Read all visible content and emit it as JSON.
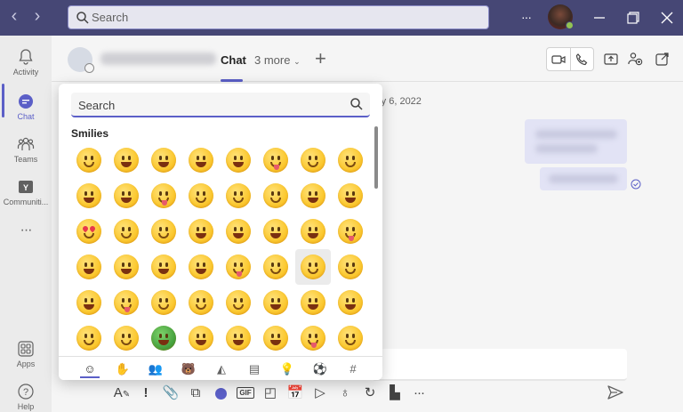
{
  "titlebar": {
    "search_placeholder": "Search",
    "more_label": "···",
    "back_glyph": "‹",
    "forward_glyph": "›"
  },
  "rail": {
    "items": [
      {
        "label": "Activity",
        "icon": "bell-icon"
      },
      {
        "label": "Chat",
        "icon": "chat-icon",
        "active": true
      },
      {
        "label": "Teams",
        "icon": "teams-icon"
      },
      {
        "label": "Communiti...",
        "icon": "communities-icon"
      },
      {
        "label": "···",
        "icon": "more-icon"
      },
      {
        "label": "Apps",
        "icon": "apps-icon"
      },
      {
        "label": "Help",
        "icon": "help-icon"
      }
    ]
  },
  "chat_header": {
    "tab_chat": "Chat",
    "tab_more": "3 more",
    "tab_add": "+"
  },
  "messages": {
    "date_partial": "ry 6, 2022"
  },
  "emoji_panel": {
    "search_placeholder": "Search",
    "section_title": "Smilies",
    "categories": [
      "smiley-icon",
      "hand-icon",
      "people-icon",
      "animal-icon",
      "food-icon",
      "building-icon",
      "bulb-icon",
      "ball-icon",
      "symbol-icon"
    ]
  },
  "compose": {
    "toolbar_glyphs": [
      "format",
      "!",
      "attach",
      "loop",
      "emoji",
      "GIF",
      "sticker",
      "meet",
      "send-later",
      "praise",
      "update",
      "approvals",
      "more"
    ]
  },
  "colors": {
    "titlebar": "#464775",
    "accent": "#5b5fc7",
    "presence_green": "#92c353"
  }
}
